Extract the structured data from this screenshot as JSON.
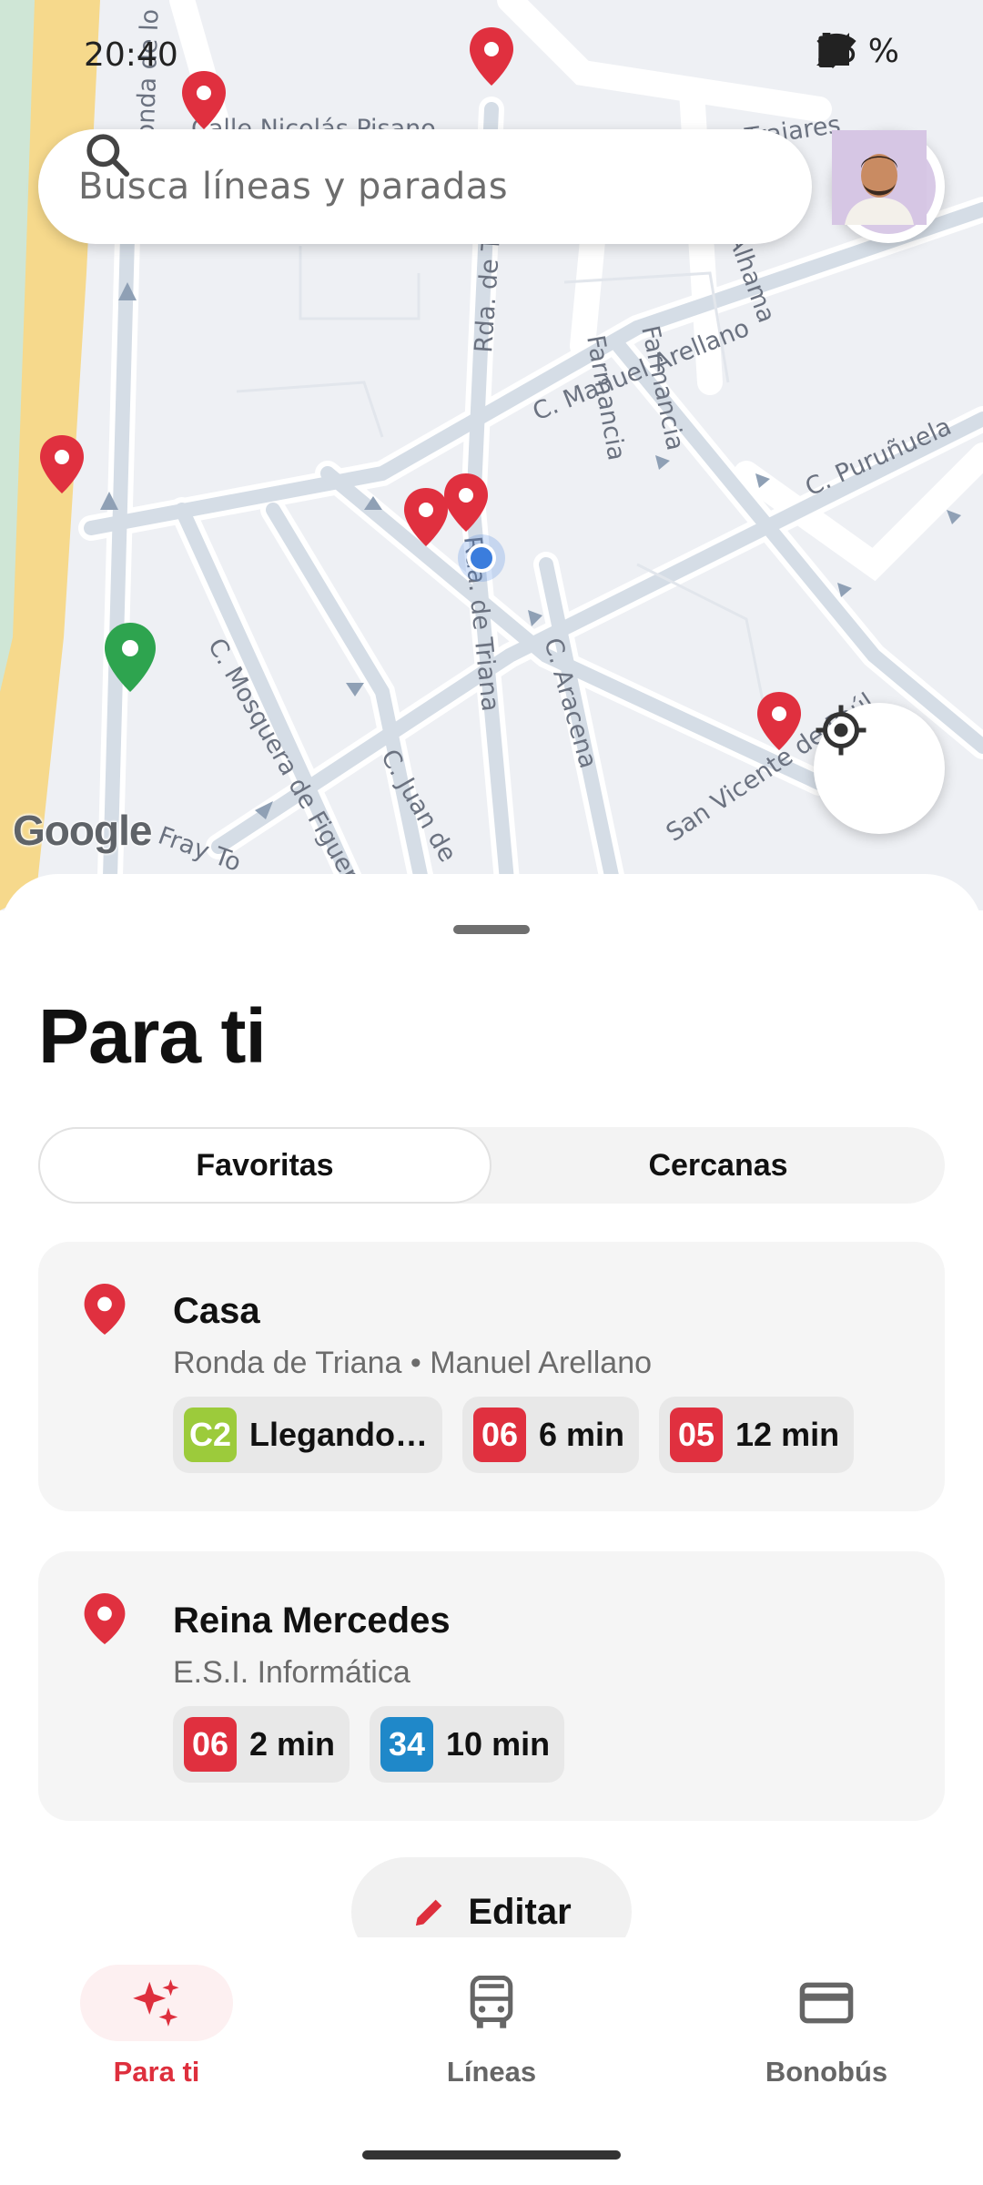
{
  "status_bar": {
    "time": "20:40",
    "battery": "55 %"
  },
  "search": {
    "placeholder": "Busca líneas y paradas"
  },
  "map": {
    "streets": [
      "Calle Nicolás Pisano",
      "C. Manuel Arellano",
      "C. Puruñuela",
      "C. Mosquera de Figueroa",
      "C. Juan de",
      "C. Aracena",
      "Rda. de Triana",
      "Rda. de T",
      "San Vicente de Paúl",
      "Ronda de lo",
      "Farmancia",
      "Farmancia",
      "Alhama",
      "Fray To",
      "Trajares"
    ],
    "attribution": "Google"
  },
  "sheet": {
    "title": "Para ti",
    "segments": [
      "Favoritas",
      "Cercanas"
    ],
    "favorites": [
      {
        "name": "Casa",
        "subtitle": "Ronda de Triana • Manuel Arellano",
        "arrivals": [
          {
            "line": "C2",
            "eta": "Llegando…",
            "color": "#9ccb3b"
          },
          {
            "line": "06",
            "eta": "6 min",
            "color": "#e0303f"
          },
          {
            "line": "05",
            "eta": "12 min",
            "color": "#e0303f"
          }
        ]
      },
      {
        "name": "Reina Mercedes",
        "subtitle": "E.S.I. Informática",
        "arrivals": [
          {
            "line": "06",
            "eta": "2 min",
            "color": "#e0303f"
          },
          {
            "line": "34",
            "eta": "10 min",
            "color": "#1f88c9"
          }
        ]
      }
    ],
    "edit_label": "Editar"
  },
  "nav": [
    {
      "label": "Para ti",
      "icon": "sparkles-icon",
      "active": true
    },
    {
      "label": "Líneas",
      "icon": "bus-icon",
      "active": false
    },
    {
      "label": "Bonobús",
      "icon": "card-icon",
      "active": false
    }
  ],
  "colors": {
    "accent": "#de2f3d",
    "pin": "#e0303f",
    "user_dot": "#3b7ddd",
    "green_pin": "#2ea44f"
  }
}
